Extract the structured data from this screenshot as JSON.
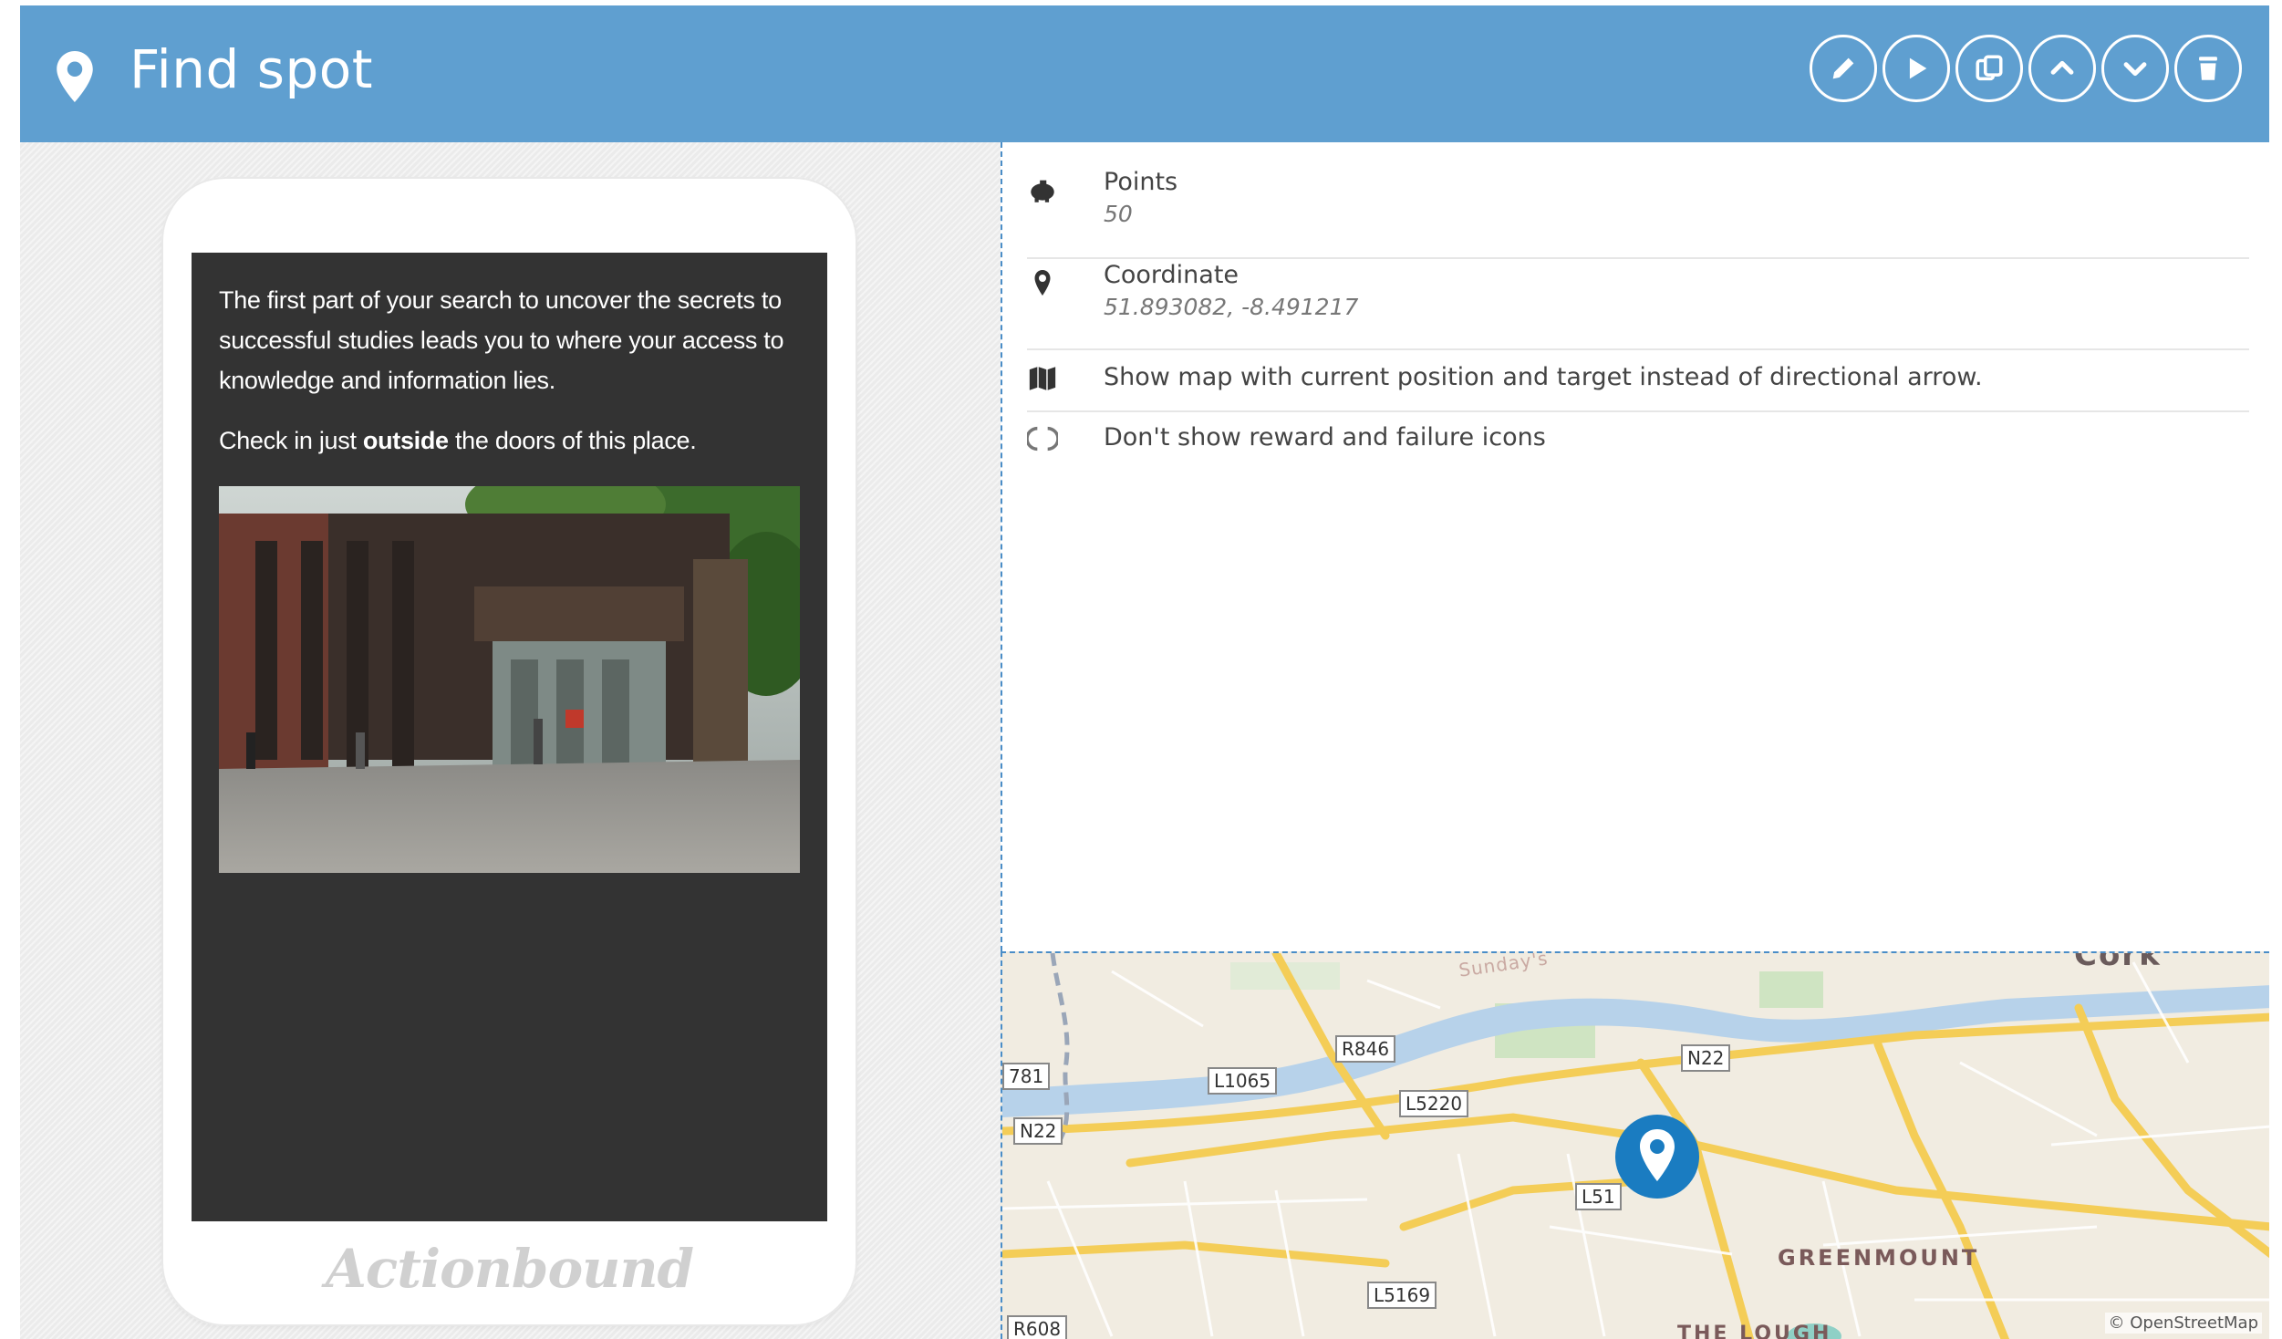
{
  "header": {
    "title": "Find spot",
    "toolbar": [
      {
        "name": "edit",
        "icon": "pencil-icon"
      },
      {
        "name": "play",
        "icon": "play-icon"
      },
      {
        "name": "duplicate",
        "icon": "copy-icon"
      },
      {
        "name": "move-up",
        "icon": "chevron-up-icon"
      },
      {
        "name": "move-down",
        "icon": "chevron-down-icon"
      },
      {
        "name": "delete",
        "icon": "trash-icon"
      }
    ]
  },
  "preview": {
    "paragraph1": "The first part of your search to uncover the secrets to successful studies leads you to where your access to knowledge and information lies.",
    "paragraph2_before": "Check in just ",
    "paragraph2_bold": "outside",
    "paragraph2_after": " the doors of this place.",
    "brand": "Actionbound"
  },
  "properties": {
    "points_label": "Points",
    "points_value": "50",
    "coordinate_label": "Coordinate",
    "coordinate_value": "51.893082, -8.491217",
    "map_option": "Show map with current position and target instead of directional arrow.",
    "icons_option": "Don't show reward and failure icons"
  },
  "map": {
    "road_labels": [
      "781",
      "R846",
      "L1065",
      "L5220",
      "N22",
      "N22",
      "L51",
      "L5169",
      "R608"
    ],
    "places": [
      "GREENMOUNT",
      "THE LOUGH",
      "Sunday's",
      "Cork"
    ],
    "attribution": "© OpenStreetMap"
  },
  "colors": {
    "header": "#5f9fd0",
    "screen": "#333333",
    "marker": "#1a7cc1"
  }
}
